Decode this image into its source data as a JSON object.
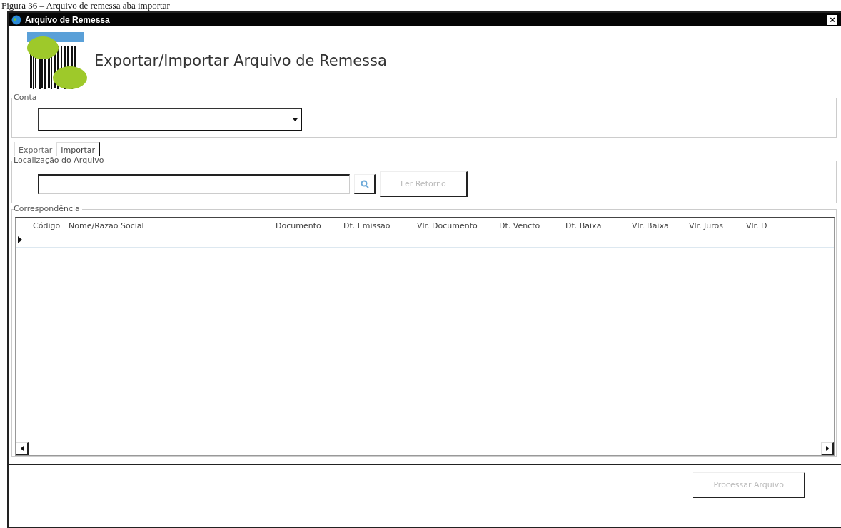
{
  "caption": "Figura 36 – Arquivo de remessa aba importar",
  "window": {
    "title": "Arquivo de Remessa",
    "close": "×"
  },
  "header": {
    "title": "Exportar/Importar Arquivo de Remessa"
  },
  "account": {
    "legend": "Conta"
  },
  "tabs": [
    {
      "label": "Exportar",
      "selected": false
    },
    {
      "label": "Importar",
      "selected": true
    }
  ],
  "file_location": {
    "legend": "Localização do Arquivo",
    "button": {
      "label": "Ler Retorno",
      "disabled": true
    }
  },
  "correspondence": {
    "legend": "Correspondência",
    "columns": [
      "Código",
      "Nome/Razão Social",
      "Documento",
      "Dt. Emissão",
      "Vlr. Documento",
      "Dt. Vencto",
      "Dt. Baixa",
      "Vlr. Baixa",
      "Vlr. Juros",
      "Vlr. D"
    ]
  },
  "footer": {
    "button": {
      "label": "Processar Arquivo",
      "disabled": true
    }
  }
}
